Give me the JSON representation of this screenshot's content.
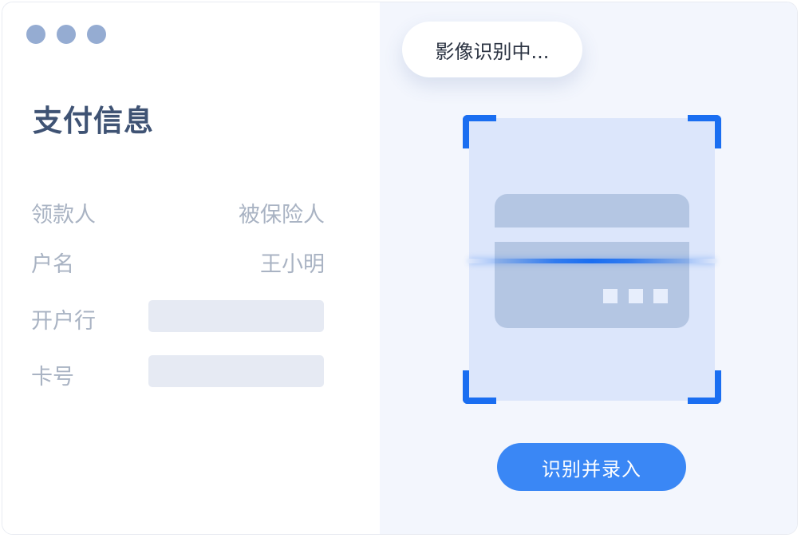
{
  "window_dots": [
    "dot-1",
    "dot-2",
    "dot-3"
  ],
  "form": {
    "title": "支付信息",
    "rows": [
      {
        "label": "领款人",
        "value": "被保险人"
      },
      {
        "label": "户名",
        "value": "王小明"
      },
      {
        "label": "开户行",
        "value": ""
      },
      {
        "label": "卡号",
        "value": ""
      }
    ]
  },
  "scanner": {
    "status": "影像识别中...",
    "card_icon": "bank-card-icon",
    "button_label": "识别并录入"
  },
  "colors": {
    "accent": "#1a6ef1",
    "button": "#3a87f5",
    "title": "#3f5374",
    "label": "#a9b3c3",
    "field_bg": "#e6eaf3",
    "right_bg": "#f3f6fd"
  }
}
